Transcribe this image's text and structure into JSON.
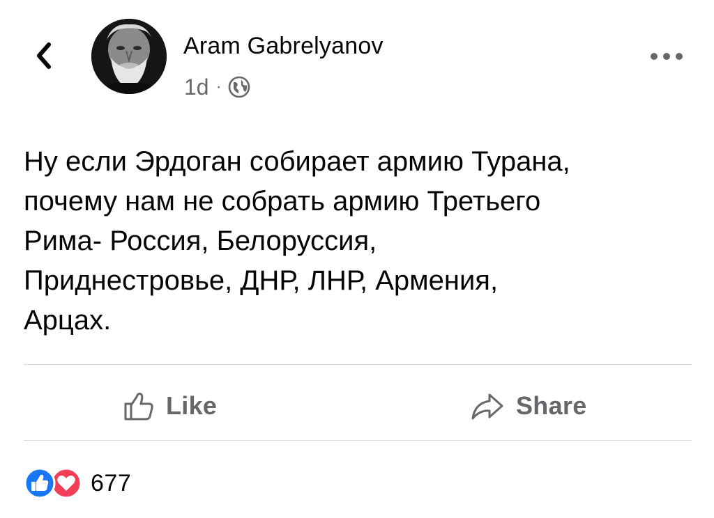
{
  "header": {
    "back_icon": "chevron-left-icon",
    "author_name": "Aram Gabrelyanov",
    "post_age": "1d",
    "separator": "·",
    "privacy_icon": "globe-icon",
    "more_icon": "more-horizontal-icon"
  },
  "post": {
    "text": "Ну если Эрдоган собирает армию Турана,\nпочему нам не собрать армию Третьего\nРима- Россия, Белоруссия,\nПриднестровье, ДНР, ЛНР, Армения,\nАрцах."
  },
  "actions": {
    "like_label": "Like",
    "share_label": "Share",
    "like_icon": "thumbs-up-outline-icon",
    "share_icon": "share-arrow-icon"
  },
  "reactions": {
    "count": "677",
    "icons": [
      "like-reaction-icon",
      "love-reaction-icon"
    ],
    "like_color": "#1877f2",
    "love_color": "#f33e58"
  },
  "colors": {
    "text": "#050505",
    "secondary": "#65676b",
    "divider": "#d9dadd"
  }
}
